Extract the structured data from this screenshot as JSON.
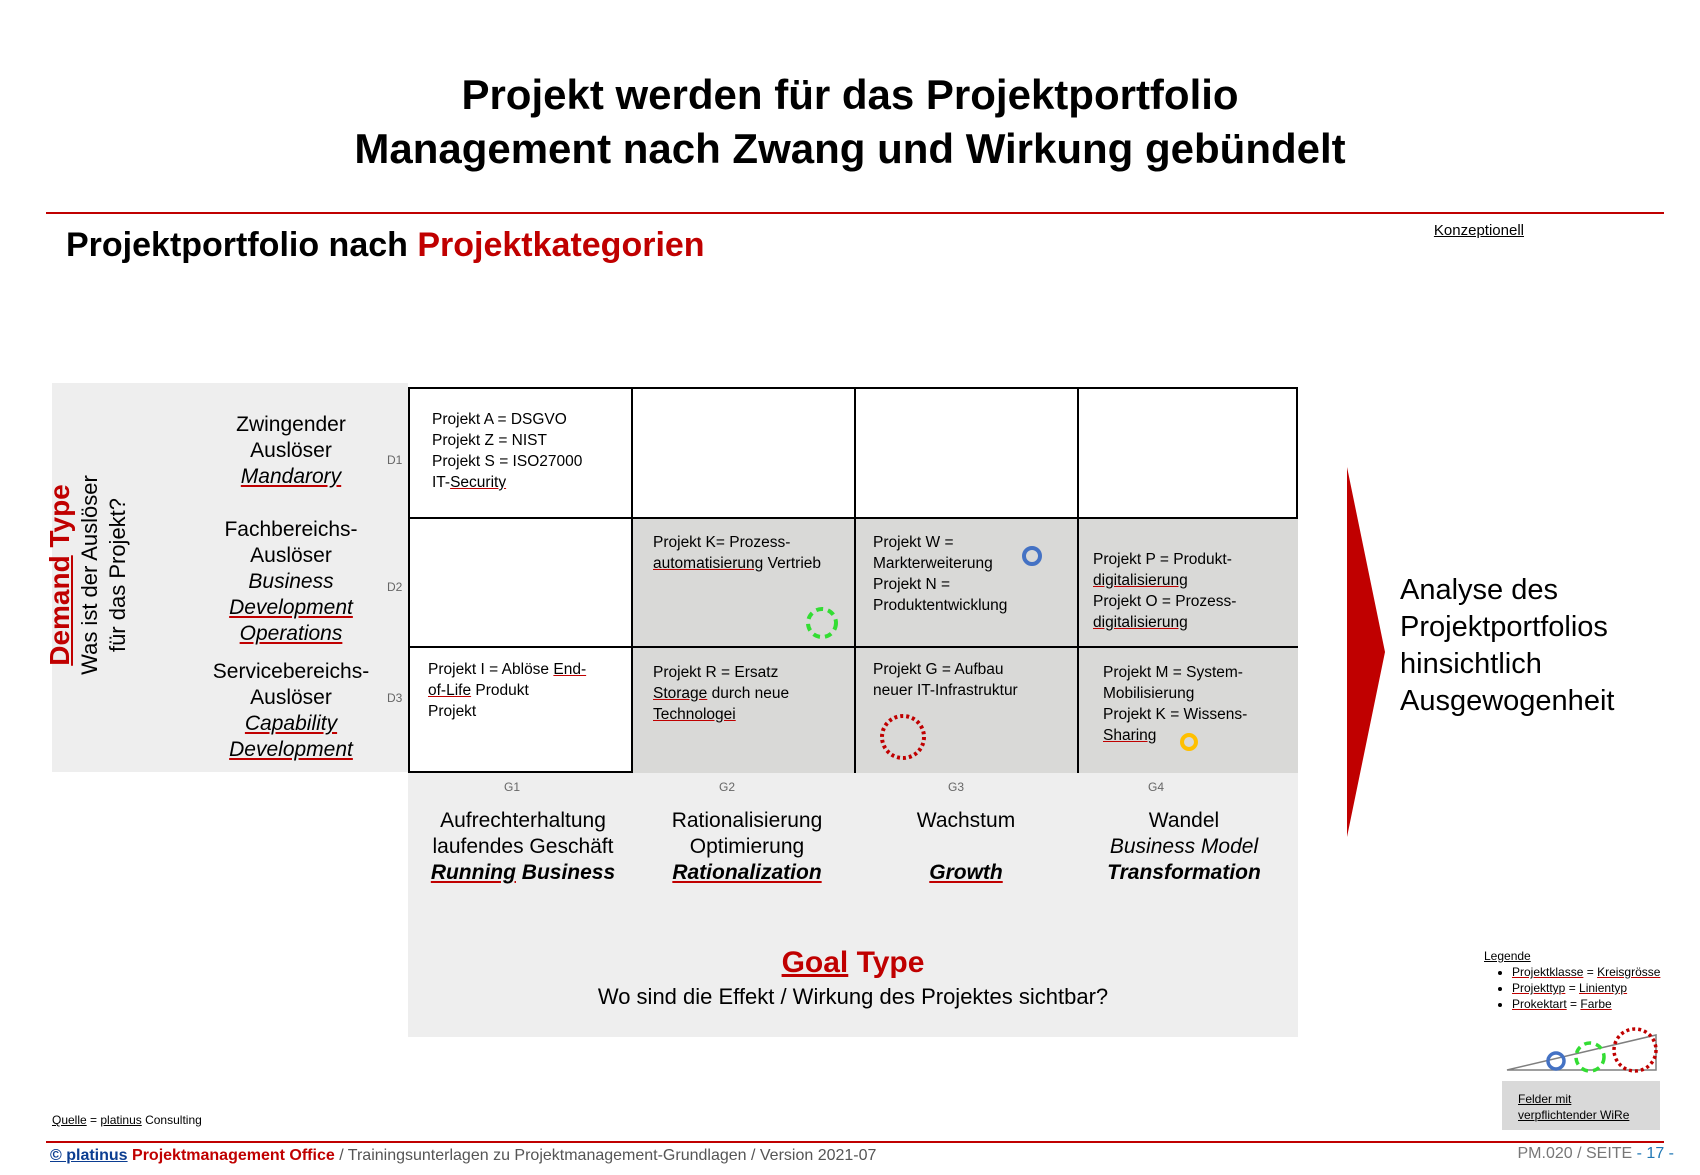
{
  "header": {
    "title_line1": "Projekt werden für das Projektportfolio",
    "title_line2": "Management nach Zwang und Wirkung gebündelt",
    "subtitle_black": "Projektportfolio nach ",
    "subtitle_red": "Projektkategorien",
    "status": "Konzeptionell"
  },
  "demand": {
    "title_underlined": "Demand",
    "title_rest": " Type",
    "question_line1": "Was ist der Auslöser",
    "question_line2": "für das Projekt?",
    "rows": [
      {
        "code": "D1",
        "line1": "Zwingender",
        "line2": "Auslöser",
        "en1": "Mandarory",
        "en2": ""
      },
      {
        "code": "D2",
        "line1": "Fachbereichs-",
        "line2": "Auslöser",
        "en1": "Business",
        "en2": "Development",
        "en3": "Operations"
      },
      {
        "code": "D3",
        "line1": "Servicebereichs-",
        "line2": "Auslöser",
        "en1": "Capability",
        "en2": "Development"
      }
    ]
  },
  "goal": {
    "title_underlined": "Goal",
    "title_rest": " Type",
    "question": "Wo sind die Effekt / Wirkung des Projektes sichtbar?",
    "columns": [
      {
        "code": "G1",
        "line1": "Aufrechterhaltung",
        "line2": "laufendes Geschäft",
        "en_a": "Running",
        "en_b": " Business"
      },
      {
        "code": "G2",
        "line1": "Rationalisierung",
        "line2": "Optimierung",
        "en_a": "Rationalization",
        "en_b": ""
      },
      {
        "code": "G3",
        "line1": "Wachstum",
        "line2": "",
        "en_a": "Growth",
        "en_b": ""
      },
      {
        "code": "G4",
        "line1": "Wandel",
        "line2": "Business Model",
        "en_a": "",
        "en_b": "Transformation"
      }
    ]
  },
  "cells": {
    "d1g1": {
      "l1": "Projekt A = DSGVO",
      "l2": "Projekt Z = NIST",
      "l3": "Projekt S = ISO27000",
      "l4a": "IT-",
      "l4b": "Security"
    },
    "d2g2": {
      "l1": "Projekt K= Prozess-",
      "l2a": "automatisierung",
      "l2b": " Vertrieb"
    },
    "d2g3": {
      "l1": "Projekt W =",
      "l2": "Markterweiterung",
      "l3": "Projekt N =",
      "l4": "Produktentwicklung"
    },
    "d2g4": {
      "l1": "Projekt P = Produkt-",
      "l2": "digitalisierung",
      "l3": "Projekt O = Prozess-",
      "l4": "digitalisierung"
    },
    "d3g1": {
      "l1a": "Projekt I = Ablöse ",
      "l1b": "End-",
      "l2a": "of-Life",
      "l2b": " Produkt",
      "l3": "Projekt"
    },
    "d3g2": {
      "l1": "Projekt  R = Ersatz",
      "l2a": "Storage",
      "l2b": " durch neue",
      "l3": "Technologei"
    },
    "d3g3": {
      "l1": "Projekt G = Aufbau",
      "l2": "neuer IT-Infrastruktur"
    },
    "d3g4": {
      "l1": "Projekt M = System-",
      "l2": "Mobilisierung",
      "l3": "Projekt K = Wissens-",
      "l4": "Sharing"
    }
  },
  "analysis": {
    "l1": "Analyse des",
    "l2": "Projektportfolios",
    "l3": "hinsichtlich",
    "l4": "Ausgewogenheit"
  },
  "legend": {
    "title": "Legende",
    "items": [
      {
        "a": "Projektklasse",
        "b": " = ",
        "c": "Kreisgrösse"
      },
      {
        "a": "Projekttyp",
        "b": " = ",
        "c": "Linientyp"
      },
      {
        "a": "Prokektart",
        "b": " = ",
        "c": "Farbe"
      }
    ],
    "box_l1": "Felder mit",
    "box_l2": "verpflichtender WiRe"
  },
  "colors": {
    "accent_red": "#c00000",
    "blue": "#4472c4",
    "green": "#33dd33",
    "orange": "#ffc000",
    "cell_gray": "#d9d9d7"
  },
  "footer": {
    "source_a": "Quelle",
    "source_b": " = ",
    "source_c": "platinus",
    "source_d": " Consulting",
    "copyright": "© platinus",
    "office": " Projektmanagement Office",
    "rest": " / Trainingsunterlagen zu Projektmanagement-Grundlagen / Version 2021-07",
    "page_prefix": "PM.020 / SEITE ",
    "page_num": "- 17 -"
  }
}
